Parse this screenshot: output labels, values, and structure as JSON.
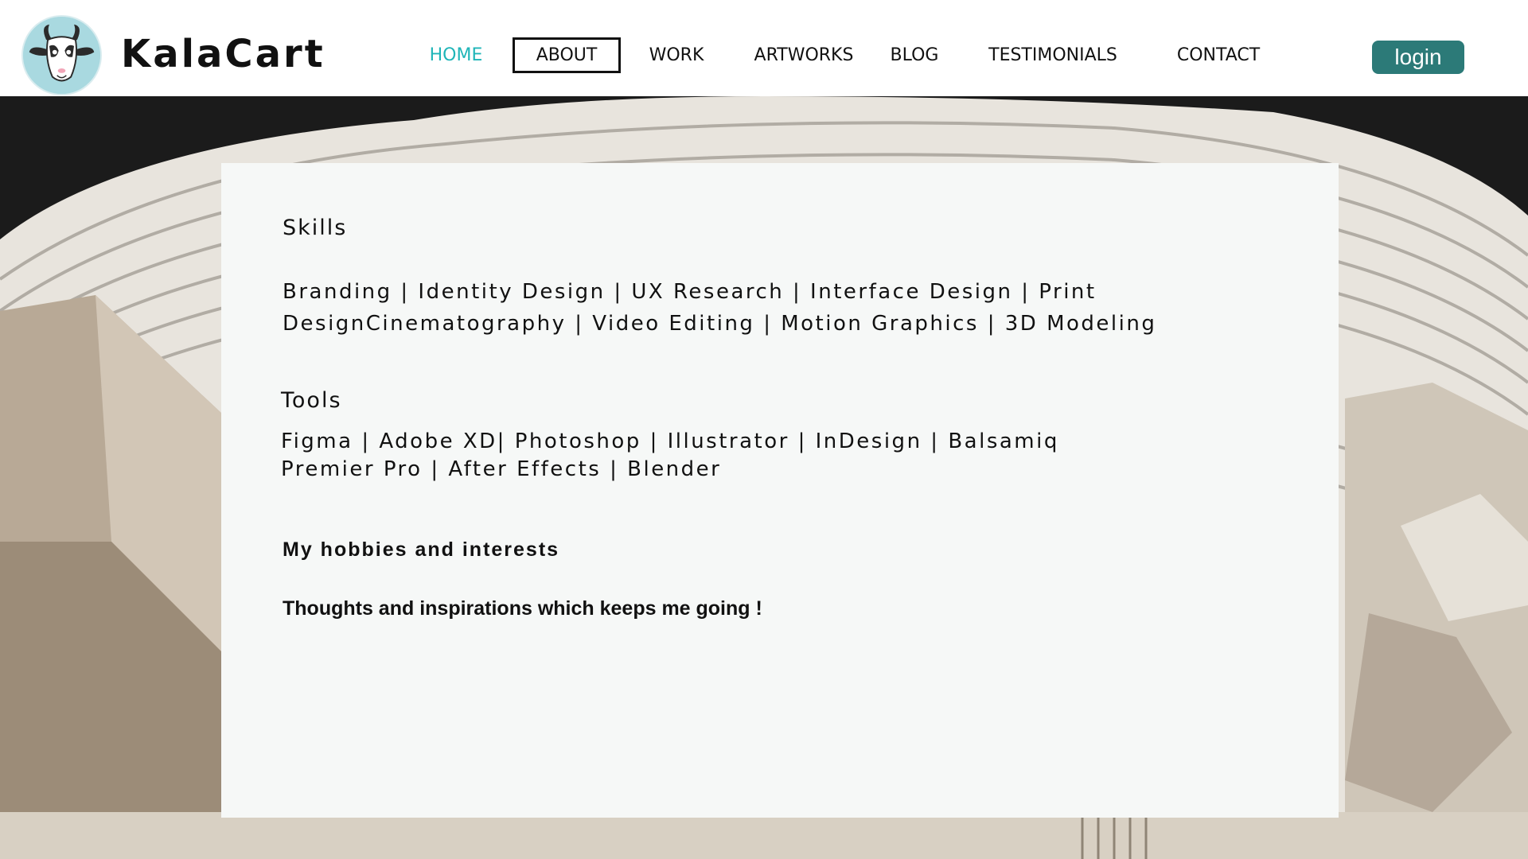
{
  "header": {
    "brand": "KalaCart",
    "nav": [
      {
        "label": "HOME"
      },
      {
        "label": "ABOUT"
      },
      {
        "label": "WORK"
      },
      {
        "label": "ARTWORKS"
      },
      {
        "label": "BLOG"
      },
      {
        "label": "TESTIMONIALS"
      },
      {
        "label": "CONTACT"
      }
    ],
    "login_label": "login"
  },
  "content": {
    "skills_heading": "Skills",
    "skills_line1": "Branding | Identity Design | UX Research | Interface Design | Print",
    "skills_line2": "DesignCinematography | Video Editing | Motion Graphics | 3D Modeling",
    "tools_heading": "Tools",
    "tools_line1": "Figma | Adobe XD| Photoshop | Illustrator | InDesign | Balsamiq",
    "tools_line2": "Premier Pro | After Effects | Blender",
    "hobbies_heading": "My hobbies and interests",
    "quote": "Thoughts and inspirations which keeps me going !"
  },
  "colors": {
    "accent_active": "#1fb5b8",
    "login_bg": "#2c7a78",
    "panel_bg": "#f6f8f7",
    "logo_badge_bg": "#a9d9e0"
  },
  "icons": {
    "logo": "goat-face-icon"
  }
}
